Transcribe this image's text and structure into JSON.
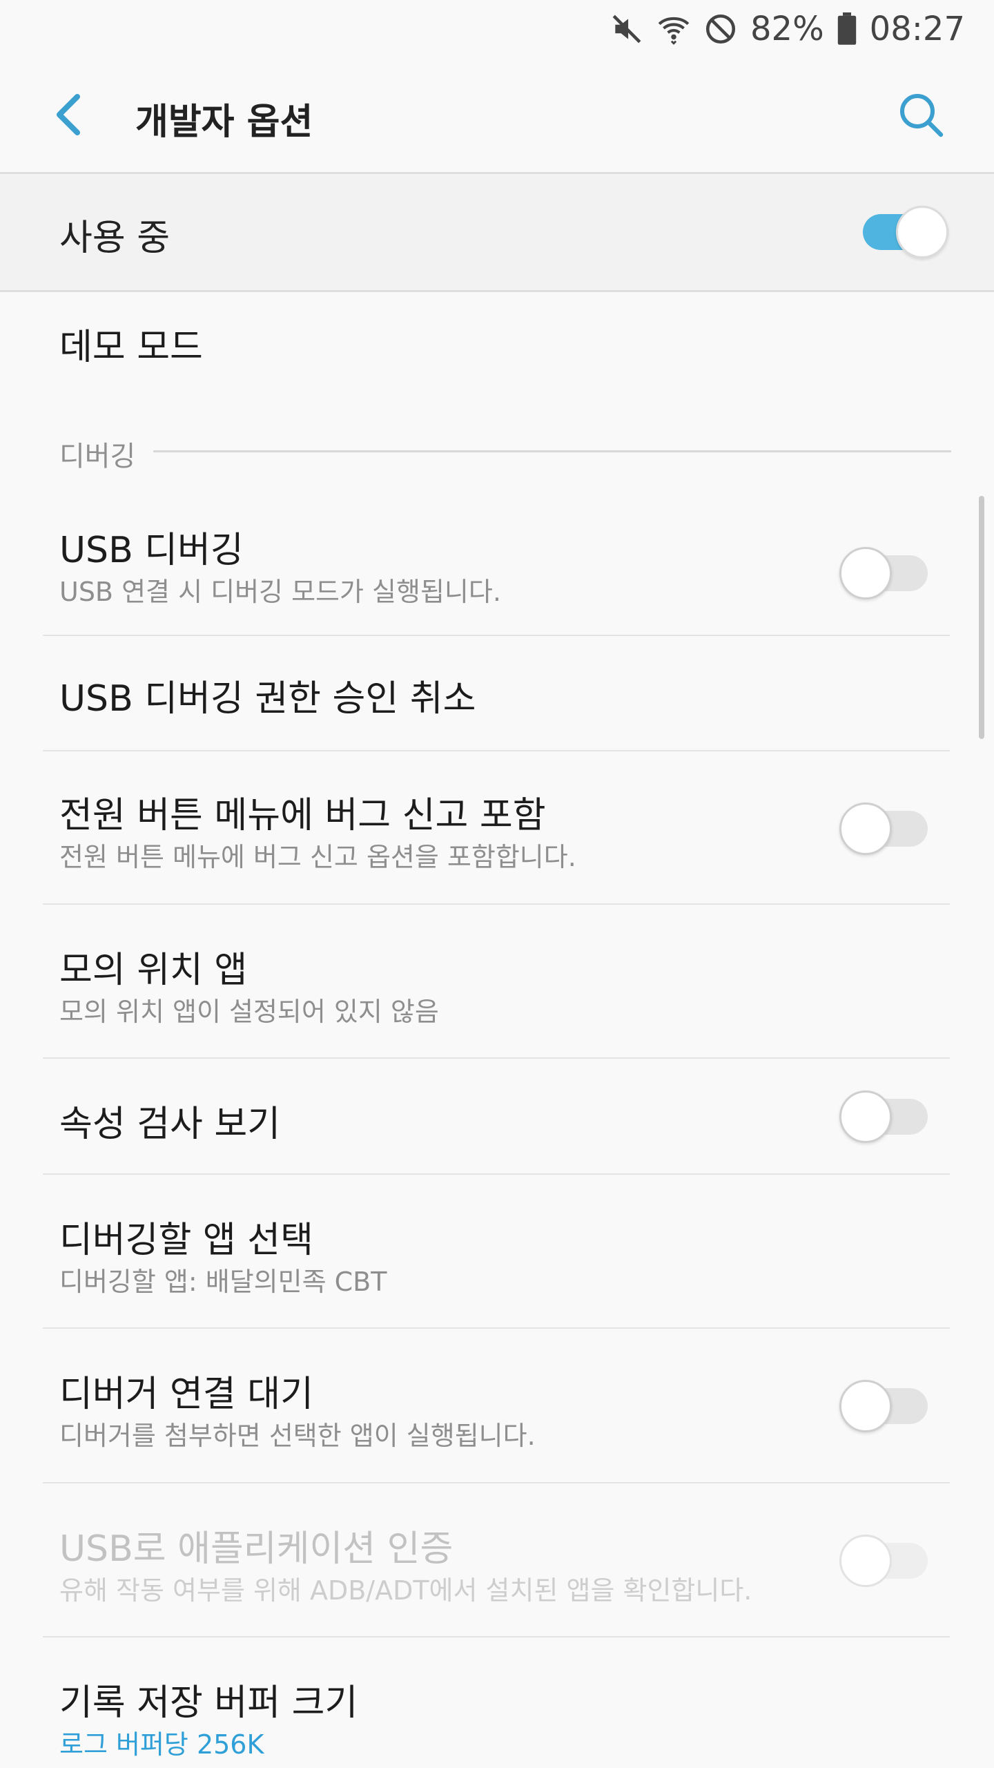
{
  "status_bar": {
    "battery_percent": "82%",
    "time": "08:27",
    "icons": [
      "mute-icon",
      "wifi-icon",
      "do-not-disturb-icon",
      "battery-icon"
    ]
  },
  "app_bar": {
    "title": "개발자 옵션",
    "back_icon": "chevron-left-icon",
    "search_icon": "search-icon"
  },
  "master_switch": {
    "label": "사용 중",
    "on": true
  },
  "demo_mode": {
    "title": "데모 모드"
  },
  "section": {
    "title": "디버깅"
  },
  "items": [
    {
      "title": "USB 디버깅",
      "subtitle": "USB 연결 시 디버깅 모드가 실행됩니다.",
      "toggle": "off"
    },
    {
      "title": "USB 디버깅 권한 승인 취소"
    },
    {
      "title": "전원 버튼 메뉴에 버그 신고 포함",
      "subtitle": "전원 버튼 메뉴에 버그 신고 옵션을 포함합니다.",
      "toggle": "off"
    },
    {
      "title": "모의 위치 앱",
      "subtitle": "모의 위치 앱이 설정되어 있지 않음"
    },
    {
      "title": "속성 검사 보기",
      "toggle": "off"
    },
    {
      "title": "디버깅할 앱 선택",
      "subtitle": "디버깅할 앱: 배달의민족 CBT"
    },
    {
      "title": "디버거 연결 대기",
      "subtitle": "디버거를 첨부하면 선택한 앱이 실행됩니다.",
      "toggle": "off"
    },
    {
      "title": "USB로 애플리케이션 인증",
      "subtitle": "유해 작동 여부를 위해 ADB/ADT에서 설치된 앱을 확인합니다.",
      "toggle": "off",
      "disabled": true
    },
    {
      "title": "기록 저장 버퍼 크기",
      "subtitle": "로그 버퍼당 256K"
    }
  ],
  "colors": {
    "accent": "#4fb4df",
    "accent_text": "#2f9fd8",
    "background": "#f9f9f9",
    "master_row_bg": "#f2f2f2"
  }
}
